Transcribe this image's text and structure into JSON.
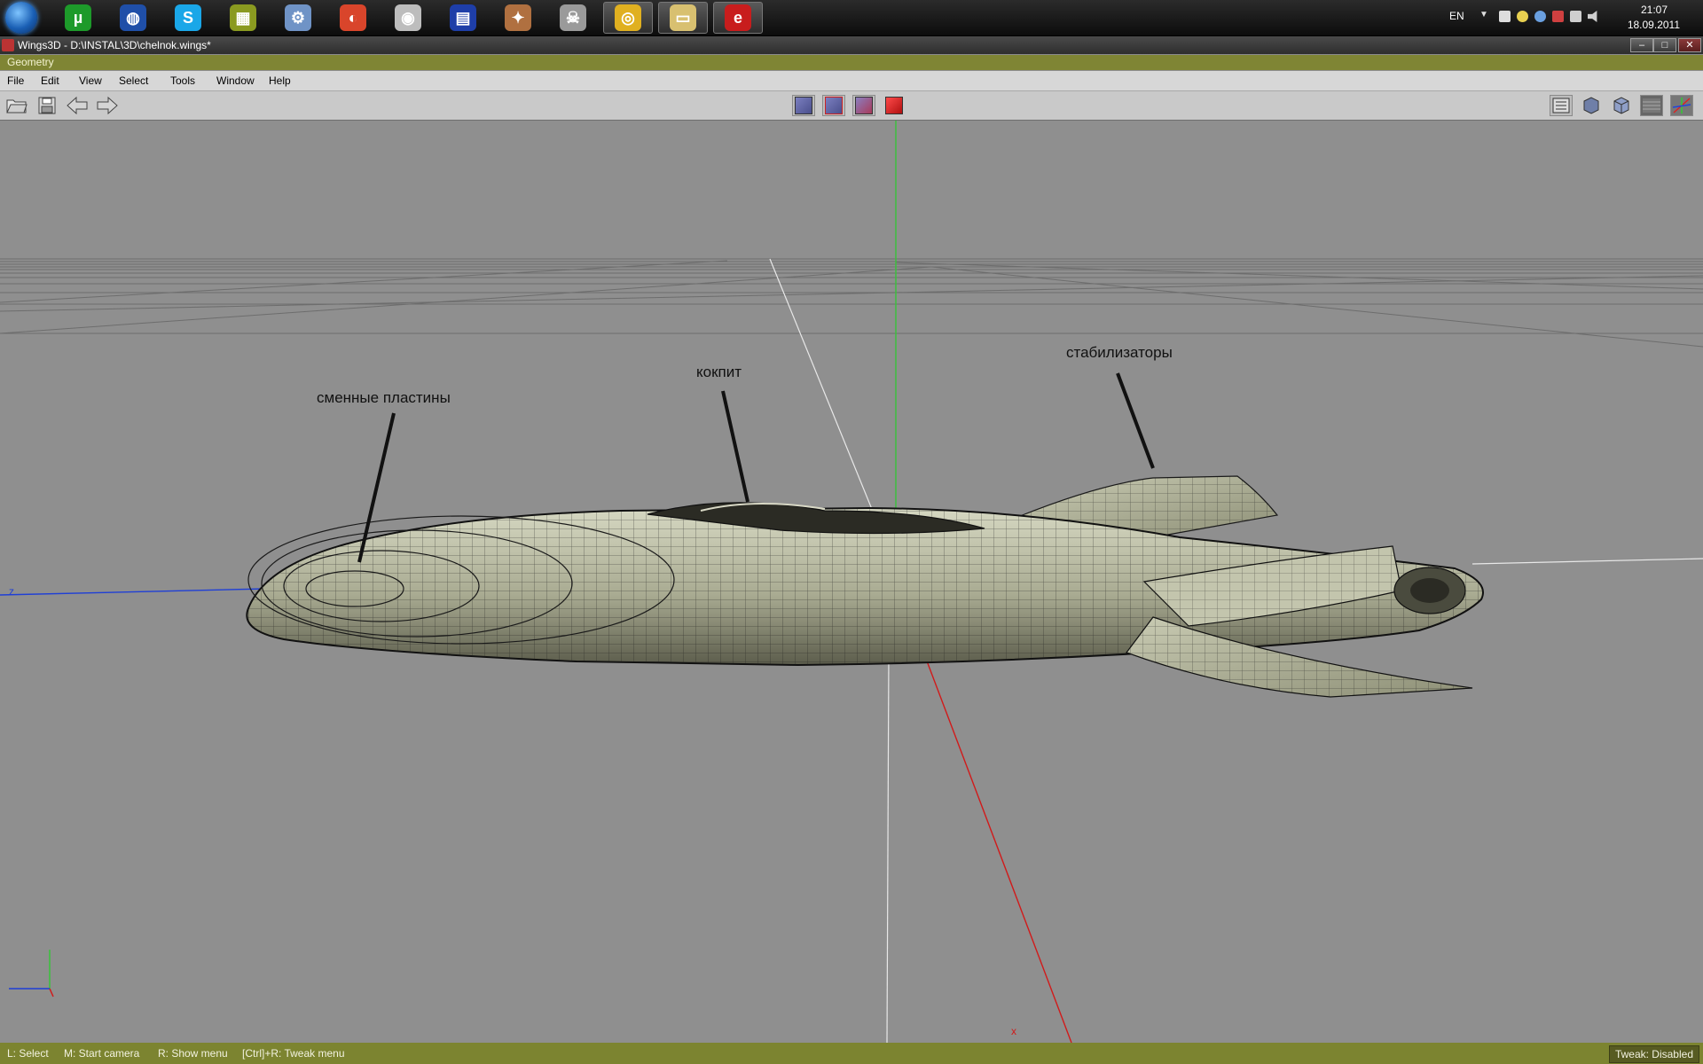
{
  "taskbar": {
    "apps": [
      {
        "name": "utorrent-icon",
        "color": "#1d9a2a",
        "glyph": "µ"
      },
      {
        "name": "google-earth-icon",
        "color": "#1f4fa8",
        "glyph": "◍"
      },
      {
        "name": "skype-icon",
        "color": "#1aa7e8",
        "glyph": "S"
      },
      {
        "name": "archive-icon",
        "color": "#8a9a20",
        "glyph": "▦"
      },
      {
        "name": "tools-icon",
        "color": "#6f93c6",
        "glyph": "⚙"
      },
      {
        "name": "browser-icon",
        "color": "#d9452b",
        "glyph": "◐"
      },
      {
        "name": "speaker-icon",
        "color": "#bdbdbd",
        "glyph": "◉"
      },
      {
        "name": "floppy-icon",
        "color": "#1e3ea8",
        "glyph": "▤"
      },
      {
        "name": "game-icon",
        "color": "#b07040",
        "glyph": "✦"
      },
      {
        "name": "wolf-icon",
        "color": "#9a9a9a",
        "glyph": "☠"
      },
      {
        "name": "chrome-icon",
        "color": "#e0b020",
        "glyph": "◎"
      },
      {
        "name": "explorer-icon",
        "color": "#d8c070",
        "glyph": "▭"
      },
      {
        "name": "erlang-icon",
        "color": "#c81d1d",
        "glyph": "e"
      }
    ],
    "tray": {
      "language": "EN",
      "time": "21:07",
      "date": "18.09.2011"
    }
  },
  "window": {
    "title": "Wings3D - D:\\INSTAL\\3D\\chelnok.wings*",
    "buttons": {
      "minimize": "–",
      "maximize": "□",
      "close": "✕"
    }
  },
  "geometry_header": "Geometry",
  "menu": [
    "File",
    "Edit",
    "View",
    "Select",
    "Tools",
    "Window",
    "Help"
  ],
  "toolbar": {
    "left_tools": [
      "open-icon",
      "save-icon",
      "undo-icon",
      "redo-icon"
    ],
    "select_modes": [
      "vertex-select-icon",
      "edge-select-icon",
      "face-select-icon",
      "body-select-icon"
    ],
    "right_tools": [
      "workmode-icon",
      "smooth-shade-icon",
      "flat-shade-icon",
      "wireframe-toggle-icon",
      "axes-toggle-icon"
    ]
  },
  "viewport": {
    "annotations": {
      "plates": "сменные пластины",
      "cockpit": "кокпит",
      "stabilizers": "стабилизаторы"
    },
    "axis_labels": {
      "z": "z",
      "x": "x"
    },
    "colors": {
      "x_axis": "#d11a1a",
      "y_axis": "#39c23a",
      "z_axis": "#1f3fd6",
      "mesh_fill": "#b8baa0",
      "mesh_edge": "#1a1a1a"
    }
  },
  "statusbar": {
    "hints": [
      "L: Select",
      "M: Start camera",
      "R: Show menu",
      "[Ctrl]+R: Tweak menu"
    ],
    "tweak": "Tweak: Disabled"
  }
}
